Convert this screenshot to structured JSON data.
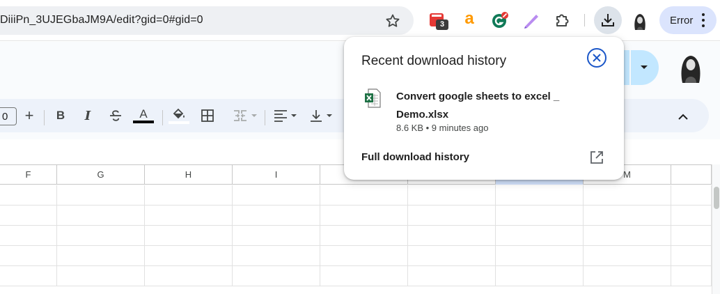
{
  "browser": {
    "url": "DiiiPn_3UJEGbaJM9A/edit?gid=0#gid=0",
    "extensions": [
      {
        "icon": "calendar-extension-icon",
        "badge": "3"
      },
      {
        "icon": "amazon-extension-icon",
        "glyph": "a"
      },
      {
        "icon": "grammar-extension-icon"
      },
      {
        "icon": "pen-extension-icon"
      },
      {
        "icon": "puzzle-extensions-icon"
      }
    ],
    "profile_chip_label": "Error",
    "accent": "#dbe4fd"
  },
  "toolbar": {
    "font_size_value": "0",
    "increase_label": "+",
    "bold_label": "B",
    "italic_label": "I",
    "strike_label": "S",
    "text_color_label": "A",
    "text_color": "#000000"
  },
  "grid": {
    "columns": [
      "F",
      "G",
      "H",
      "I",
      "",
      "",
      "",
      "M",
      ""
    ],
    "selected_column_index": 6,
    "selected_color": "#d3e3fd"
  },
  "download_popup": {
    "title": "Recent download history",
    "item": {
      "file_name": "Convert google sheets to excel _ Demo.xlsx",
      "meta": "8.6 KB • 9 minutes ago",
      "icon": "excel-file-icon"
    },
    "full_history_label": "Full download history",
    "close_color": "#1a56c8"
  }
}
